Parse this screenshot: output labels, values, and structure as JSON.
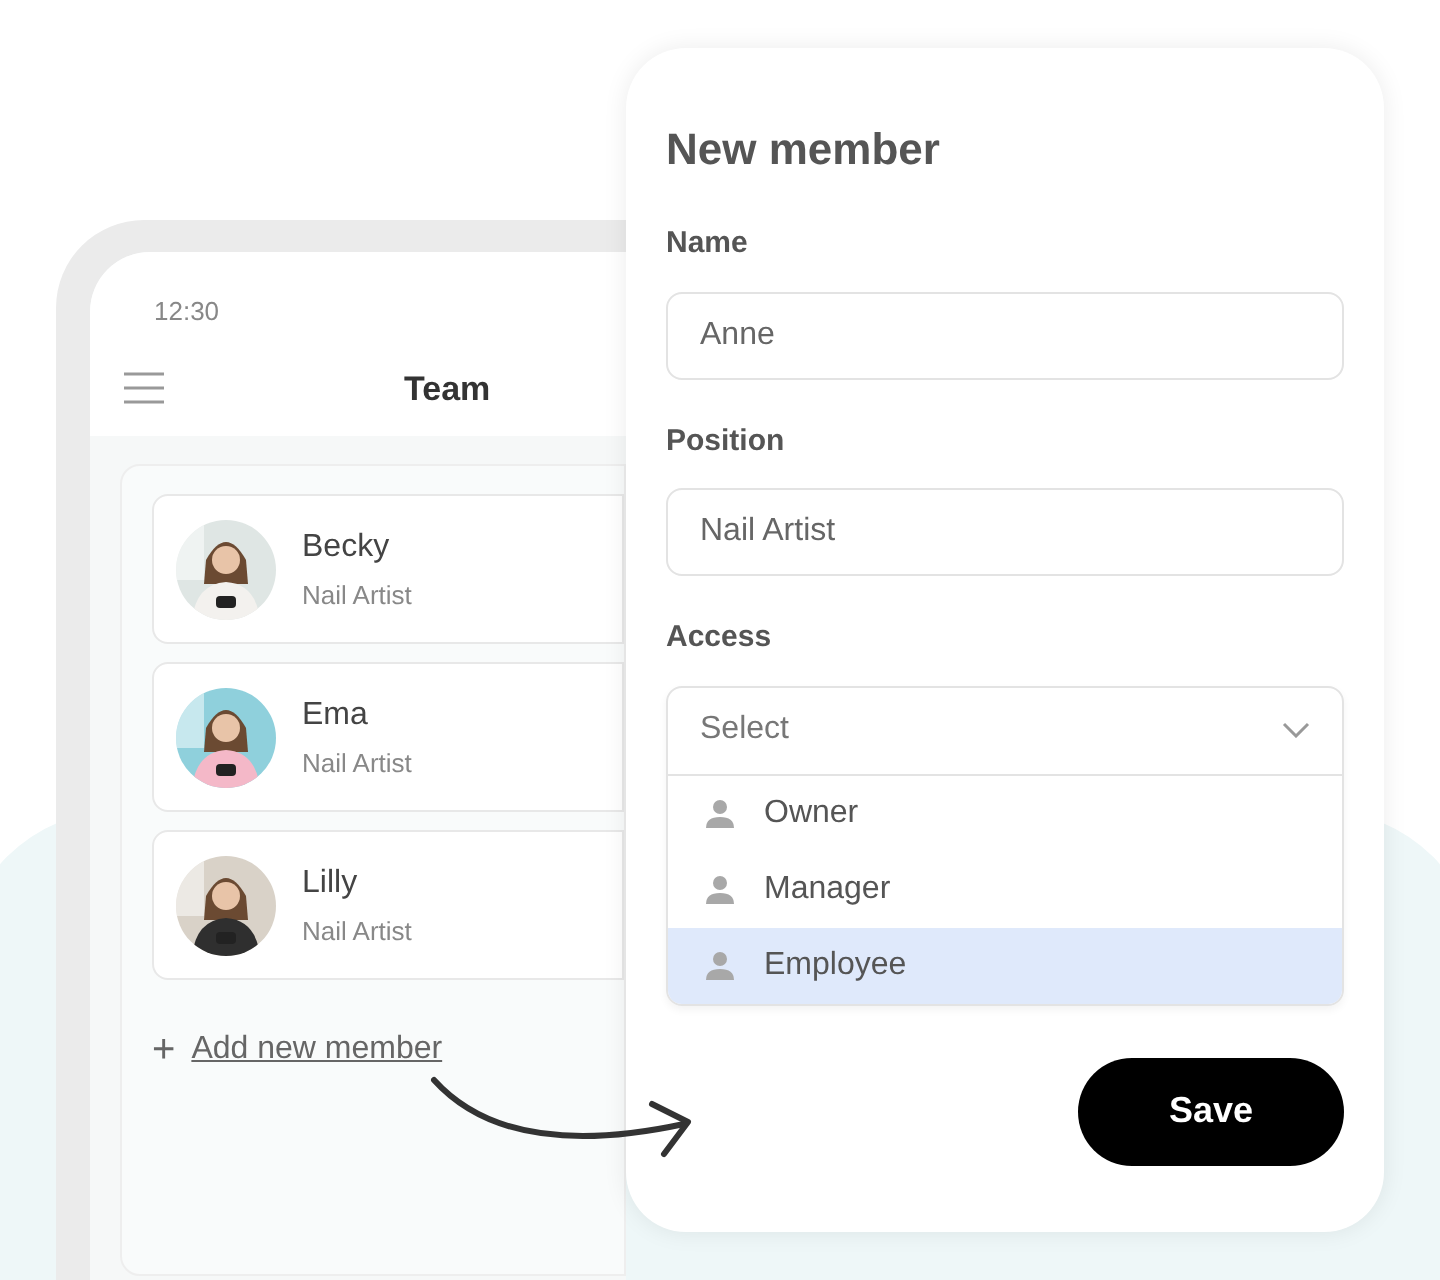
{
  "phone": {
    "time": "12:30",
    "title": "Team"
  },
  "members": [
    {
      "name": "Becky",
      "position": "Nail Artist"
    },
    {
      "name": "Ema",
      "position": "Nail Artist"
    },
    {
      "name": "Lilly",
      "position": "Nail Artist"
    }
  ],
  "add_member": {
    "icon": "+",
    "label": "Add new member"
  },
  "form": {
    "title": "New member",
    "fields": [
      {
        "label": "Name",
        "value": "Anne"
      },
      {
        "label": "Position",
        "value": "Nail Artist"
      }
    ],
    "access": {
      "label": "Access",
      "placeholder": "Select",
      "options": [
        {
          "label": "Owner",
          "selected": false
        },
        {
          "label": "Manager",
          "selected": false
        },
        {
          "label": "Employee",
          "selected": true
        }
      ]
    },
    "save": "Save"
  }
}
